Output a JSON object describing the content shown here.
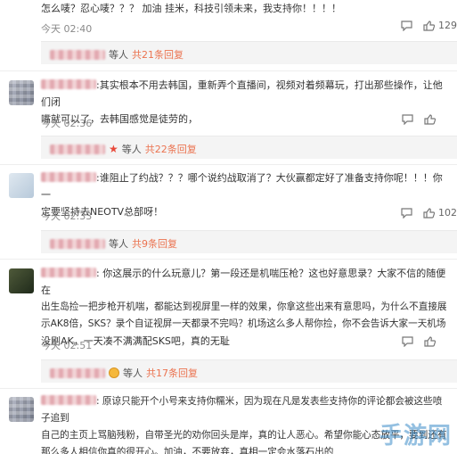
{
  "comments": [
    {
      "lines": [
        "怎么唛？忍心唛？？？    加油 挂米，科技引领未来，我支持你！！！！"
      ],
      "time": "今天 02:40",
      "reply_count": "129",
      "replies": {
        "prefix": "等人",
        "count": "共21条回复"
      }
    },
    {
      "lines": [
        ":其实根本不用去韩国，重新弄个直播间，视频对着频幕玩，打出那些操作，让他们闭",
        "嘴就可以了，去韩国感觉是徒劳的，"
      ],
      "time": "今天 02:36",
      "replies": {
        "prefix": "等人",
        "count": "共22条回复"
      }
    },
    {
      "lines": [
        ":谁阻止了约战？？？哪个说约战取消了？大伙赢都定好了准备支持你呢！！！你一",
        "定要坚持去NEOTV总部呀！"
      ],
      "time": "今天 02:33",
      "reply_count": "102",
      "replies": {
        "prefix": "等人",
        "count": "共9条回复"
      }
    },
    {
      "lines": [
        ": 你这展示的什么玩意儿？第一段还是机喘压枪？这也好意思录？大家不信的随便在",
        "出生岛捡一把步枪开机喘，都能达到视屏里一样的效果，你拿这些出来有意思吗，为什么不直接展",
        "示AK8倍，SKS？录个自证视屏一天都录不完吗？机场这么多人帮你捡，你不会告诉大家一天机场",
        "没刷AK，一天凑不满满配SKS吧，真的无耻"
      ],
      "time": "今天 02:51",
      "replies": {
        "prefix": "等人",
        "count": "共17条回复"
      }
    },
    {
      "lines": [
        ": 原谅只能开个小号来支持你糯米，因为现在凡是发表些支持你的评论都会被这些喷子追到",
        "自己的主页上骂脑残粉，自带圣光的劝你回头是岸，真的让人恶心。希望你能心态放平，要到还有",
        "那么多人相信你真的很开心。加油，不要放弃，真相一定会水落石出的"
      ]
    }
  ],
  "actions": {
    "comment_icon": "comment-icon",
    "like_icon": "thumb-up-icon"
  },
  "watermark": "手游网"
}
